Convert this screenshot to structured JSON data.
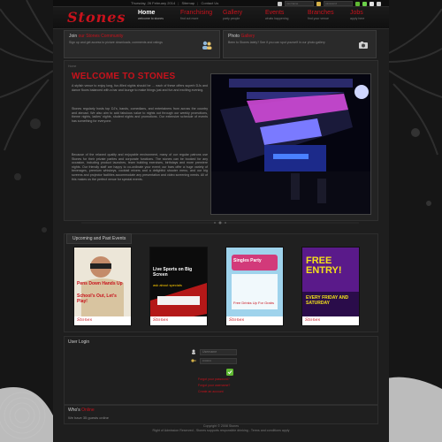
{
  "topbar": {
    "date": "Thursday, 26 February 2014",
    "links": [
      "Sitemap",
      "Contact Us"
    ],
    "username_placeholder": "username",
    "password_placeholder": "password"
  },
  "brand": {
    "logo": "Stones"
  },
  "nav": [
    {
      "label": "Home",
      "sub": "welcome to stones"
    },
    {
      "label": "Franchising",
      "sub": "find out more"
    },
    {
      "label": "Gallery",
      "sub": "party people"
    },
    {
      "label": "Events",
      "sub": "whats happening"
    },
    {
      "label": "Branches",
      "sub": "find your venue"
    },
    {
      "label": "Jobs",
      "sub": "apply here"
    }
  ],
  "promo_left": {
    "title_plain": "Join",
    "title_red": "our Stones Community",
    "body": "Sign up and get access to picture downloads, comments and ratings"
  },
  "promo_right": {
    "title_plain": "Photo",
    "title_red": "Gallery",
    "body": "Been to Stones lately? See if you can spot yourself in our photo gallery"
  },
  "main": {
    "breadcrumb": "Home",
    "title": "WELCOME TO STONES",
    "p1": "A stylish venue to enjoy long, fun-filled nights should be … each of these offers superb DJs and dance floors balanced with a bar and lounge to make things just and fun and exciting evening.",
    "p2": "Stones regularly hosts top DJ's, bands, comedians, and entertainers from across the country and abroad. We also aim to add fabulous value to nights out through our weekly promotions, theme nights, ladies' nights, student nights and promotions. Our extensive schedule of events has something for everyone.",
    "p3": "Because of the relaxed quality and enjoyable environment, many of our regular patrons use Stones for their private parties and corporate functions. The stones can be booked for any occasion, including product launches, team building exercises, birthdays and more premiere nights. Our friendly staff are happy to co-ordinate your event; our bars offer a huge variety of beverages, premium whiskeys, cocktail mixers and a delightful shooter menu, and our big screens and projector facilities accommodate any presentation and video screening needs. All of this makes us the perfect venue for special events."
  },
  "events": {
    "tab_plain": "Upcoming",
    "tab_rest": "and Past Events",
    "posters": [
      {
        "headline": "Pens Down Hands Up",
        "sub": "School's Out, Let's Play!",
        "brand": "Stones"
      },
      {
        "headline": "Live Sports on Big Screen",
        "sub": "ask about specials",
        "brand": "Stones"
      },
      {
        "headline": "Singles Party",
        "sub": "Free Drinks Up For Grabs",
        "brand": "Stones"
      },
      {
        "headline": "FREE ENTRY!",
        "sub": "EVERY FRIDAY AND SATURDAY",
        "brand": "Stones"
      }
    ]
  },
  "user_login": {
    "title_plain": "User",
    "title_rest": "Login",
    "username": "Username",
    "password": "••••••••",
    "links": [
      "Forgot your password?",
      "Forgot your username?",
      "Create an account"
    ]
  },
  "whos_online": {
    "title_plain": "Who's",
    "title_red": "Online",
    "text": "We have 35 guests online"
  },
  "footer": {
    "line1": "Copyright © 2008 Stones",
    "line2": "Right of Admission Reserved - Stones supports responsible drinking - Terms and conditions apply"
  }
}
